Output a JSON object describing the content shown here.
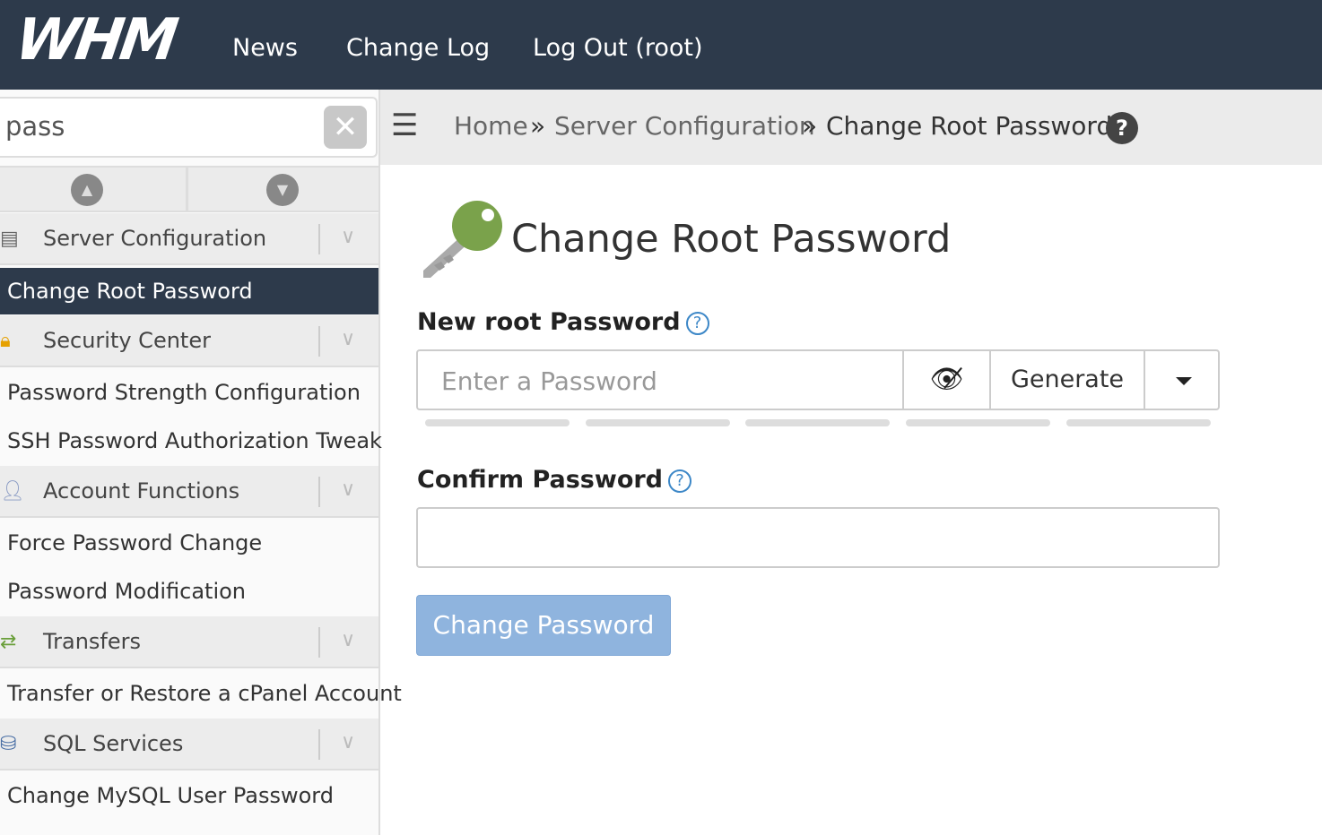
{
  "header": {
    "logo": "WHM",
    "nav": [
      "News",
      "Change Log",
      "Log Out (root)"
    ]
  },
  "sidebar": {
    "search_value": "pass",
    "groups": [
      {
        "label": "Server Configuration",
        "icon": "server-gear-icon",
        "items": [
          "Change Root Password"
        ],
        "active": "Change Root Password"
      },
      {
        "label": "Security Center",
        "icon": "lock-icon",
        "items": [
          "Password Strength Configuration",
          "SSH Password Authorization Tweak"
        ]
      },
      {
        "label": "Account Functions",
        "icon": "user-gear-icon",
        "items": [
          "Force Password Change",
          "Password Modification"
        ]
      },
      {
        "label": "Transfers",
        "icon": "transfer-arrows-icon",
        "items": [
          "Transfer or Restore a cPanel Account"
        ]
      },
      {
        "label": "SQL Services",
        "icon": "database-icon",
        "items": [
          "Change MySQL User Password"
        ]
      }
    ]
  },
  "breadcrumb": {
    "items": [
      "Home",
      "Server Configuration",
      "Change Root Password"
    ],
    "separator": "»"
  },
  "main": {
    "title": "Change Root Password",
    "new_label": "New root Password",
    "new_placeholder": "Enter a Password",
    "generate": "Generate",
    "confirm_label": "Confirm Password",
    "submit": "Change Password",
    "strength_level": 0
  },
  "colors": {
    "header": "#2d3a4b",
    "accent": "#3c87c7",
    "button": "#8fb4de"
  }
}
